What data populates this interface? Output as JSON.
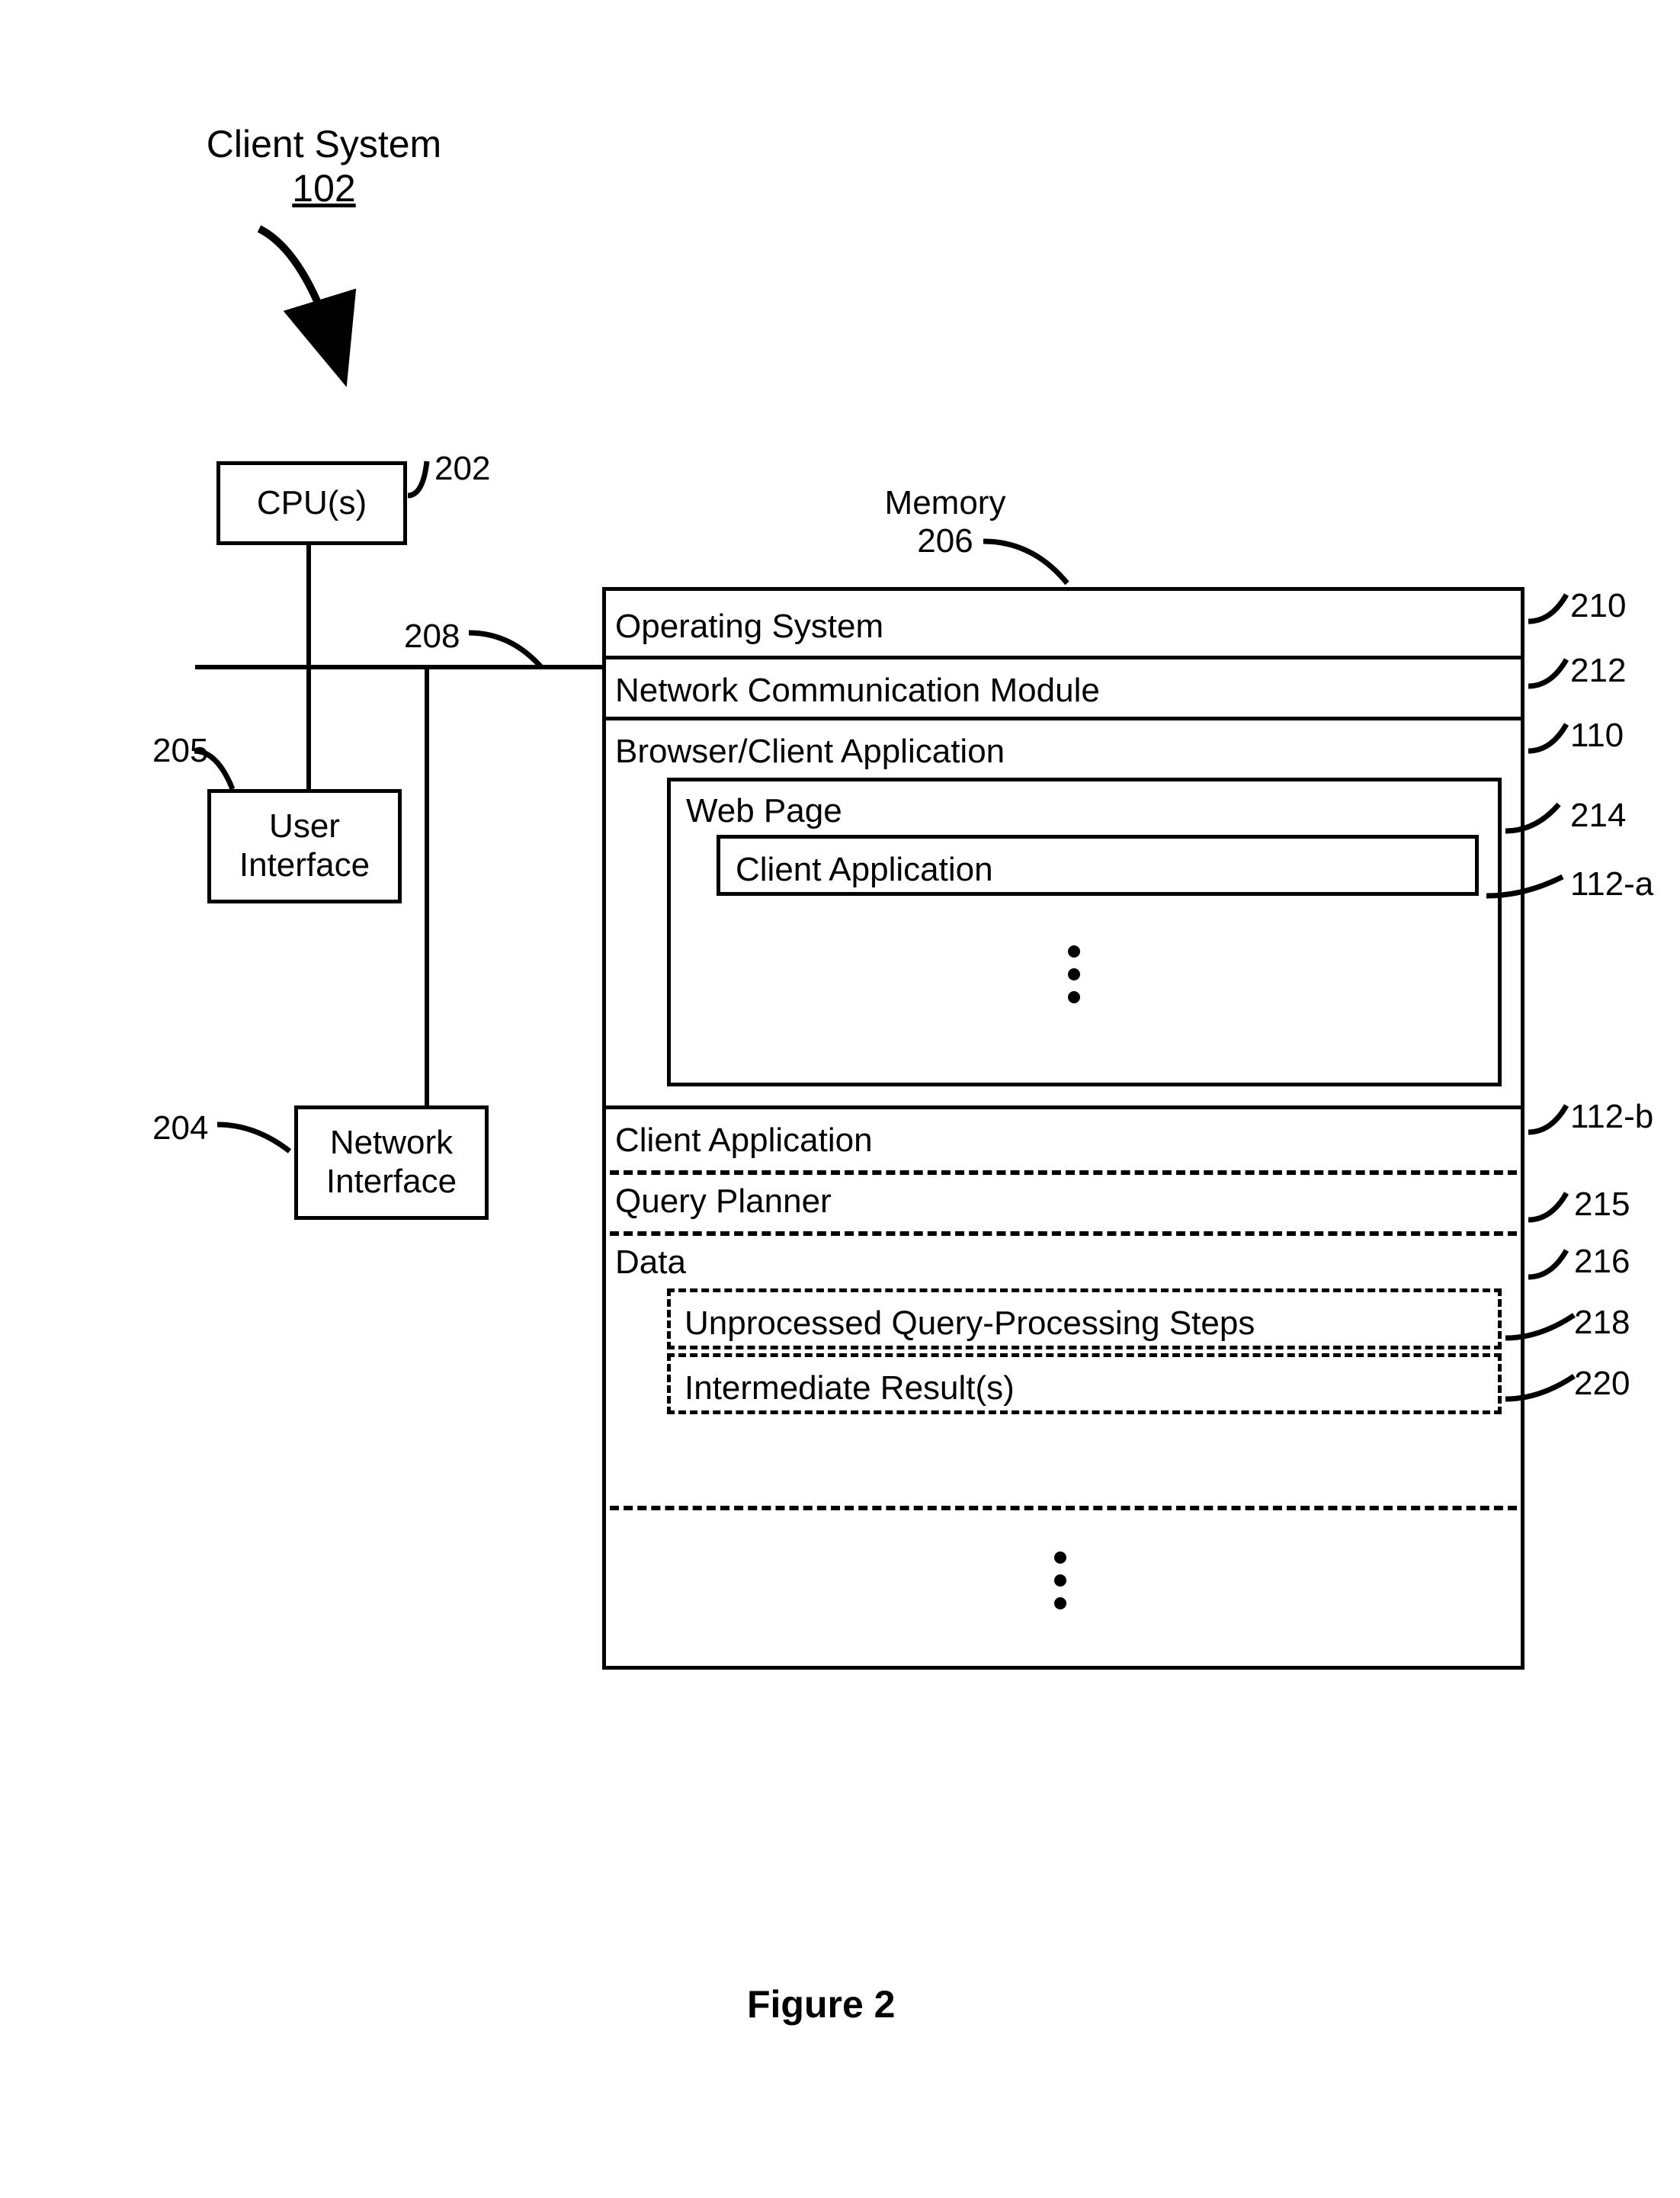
{
  "title": {
    "text": "Client System",
    "num": "102"
  },
  "blocks": {
    "cpu": {
      "label": "CPU(s)",
      "ref": "202"
    },
    "ui": {
      "label": "User\nInterface",
      "ref": "205"
    },
    "net": {
      "label": "Network\nInterface",
      "ref": "204"
    },
    "bus": {
      "ref": "208"
    },
    "mem": {
      "label": "Memory",
      "ref": "206"
    }
  },
  "memory": {
    "os": {
      "label": "Operating System",
      "ref": "210"
    },
    "netcomm": {
      "label": "Network Communication Module",
      "ref": "212"
    },
    "browser": {
      "label": "Browser/Client Application",
      "ref": "110"
    },
    "webpage": {
      "label": "Web Page",
      "ref": "214"
    },
    "clientapp_in": {
      "label": "Client Application",
      "ref": "112-a"
    },
    "clientapp_out": {
      "label": "Client Application",
      "ref": "112-b"
    },
    "queryplanner": {
      "label": "Query Planner",
      "ref": "215"
    },
    "data": {
      "label": "Data",
      "ref": "216"
    },
    "unproc": {
      "label": "Unprocessed Query-Processing Steps",
      "ref": "218"
    },
    "interm": {
      "label": "Intermediate Result(s)",
      "ref": "220"
    }
  },
  "caption": "Figure 2"
}
